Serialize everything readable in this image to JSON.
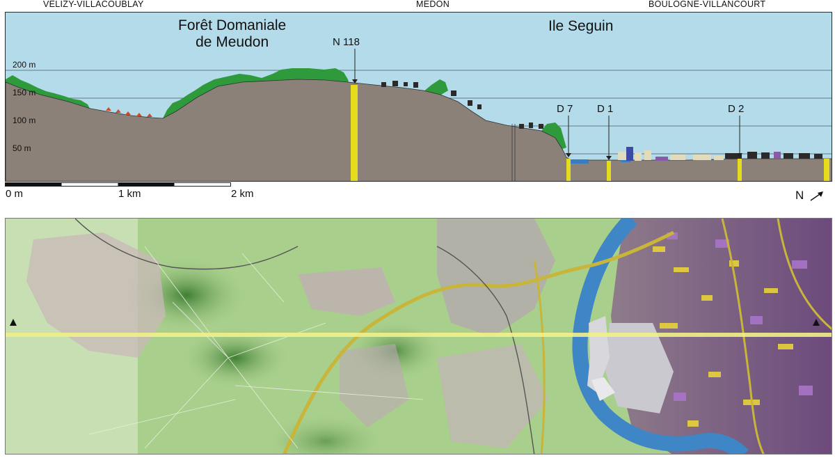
{
  "towns": {
    "west": "VELIZY-VILLACOUBLAY",
    "center": "MEDON",
    "east": "BOULOGNE-VILLANCOURT"
  },
  "profile": {
    "forest_line1": "Forêt Domaniale",
    "forest_line2": "de Meudon",
    "island": "Ile Seguin",
    "roads": {
      "n118": "N 118",
      "d7": "D 7",
      "d1": "D 1",
      "d2": "D 2"
    },
    "altitudes": [
      "200 m",
      "150 m",
      "100 m",
      "50 m"
    ],
    "colors": {
      "sky": "#b3dbea",
      "ground": "#8b8179",
      "vegetation": "#2e9a3c",
      "road_marker": "#e6dc1e",
      "river": "#3a7cc4"
    }
  },
  "scale": {
    "start": "0 m",
    "mid": "1 km",
    "end": "2 km"
  },
  "north": {
    "label": "N",
    "icon": "north-arrow-icon"
  },
  "map": {
    "colors": {
      "forest": "#a8cf8e",
      "forest_dark": "#4f8a3f",
      "river": "#3f86c6",
      "urban_purple": "#8a5aa8",
      "urban_yellow": "#e8d23a",
      "section_line": "#efef8a",
      "road": "#c9b53a"
    }
  }
}
